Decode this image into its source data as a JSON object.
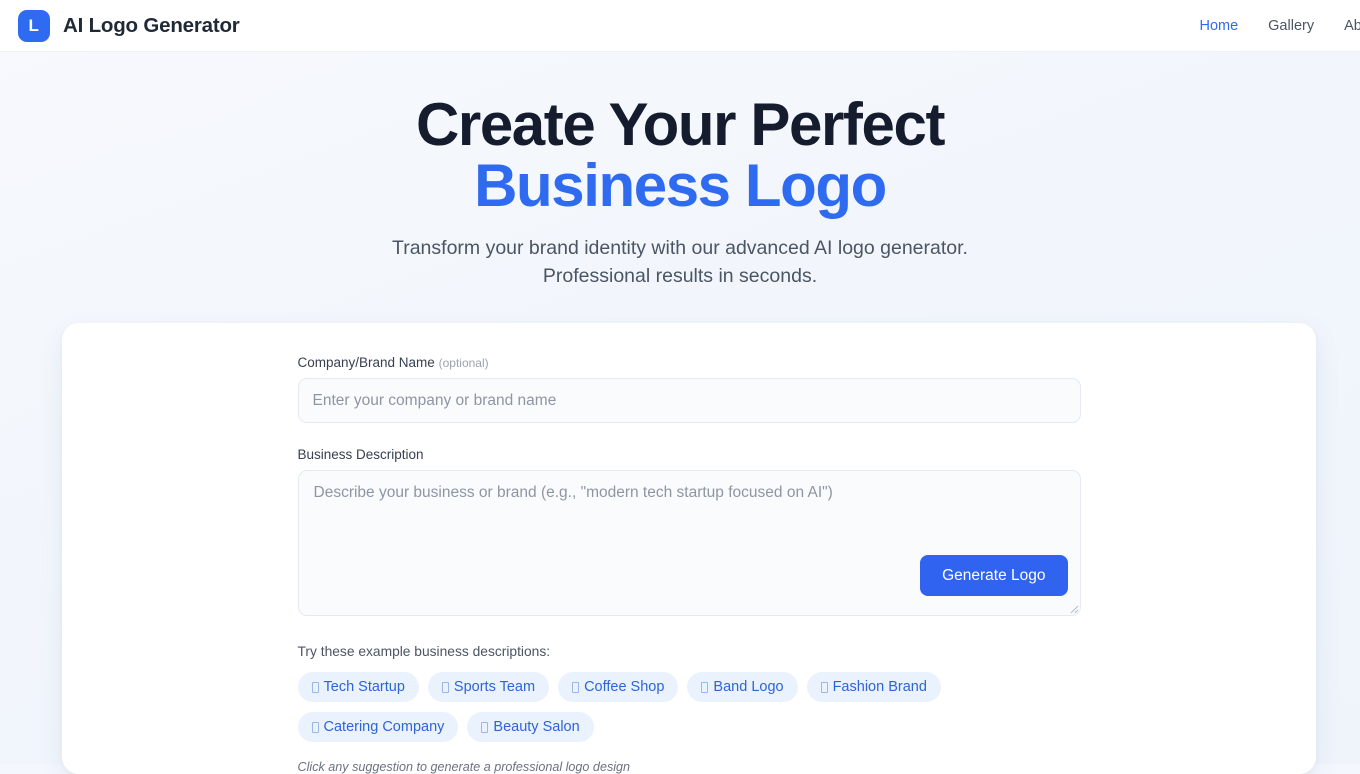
{
  "header": {
    "logo_letter": "L",
    "title": "AI Logo Generator",
    "nav": [
      {
        "label": "Home",
        "active": true
      },
      {
        "label": "Gallery",
        "active": false
      },
      {
        "label": "About",
        "active": false
      }
    ]
  },
  "hero": {
    "title_line1": "Create Your Perfect",
    "title_line2": "Business Logo",
    "subtitle_line1": "Transform your brand identity with our advanced AI logo generator.",
    "subtitle_line2": "Professional results in seconds."
  },
  "form": {
    "brand_name": {
      "label": "Company/Brand Name",
      "optional_tag": "(optional)",
      "value": "",
      "placeholder": "Enter your company or brand name"
    },
    "description": {
      "label": "Business Description",
      "value": "",
      "placeholder": "Describe your business or brand (e.g., \"modern tech startup focused on AI\")"
    },
    "generate_label": "Generate Logo",
    "examples_label": "Try these example business descriptions:",
    "examples": [
      "Tech Startup",
      "Sports Team",
      "Coffee Shop",
      "Band Logo",
      "Fashion Brand",
      "Catering Company",
      "Beauty Salon"
    ],
    "hint": "Click any suggestion to generate a professional logo design"
  },
  "colors": {
    "accent": "#2f63f0",
    "heading": "#141c2e",
    "chip_bg": "#eaf2fe",
    "chip_text": "#2f63d8",
    "page_bg": "#f2f6fc"
  }
}
